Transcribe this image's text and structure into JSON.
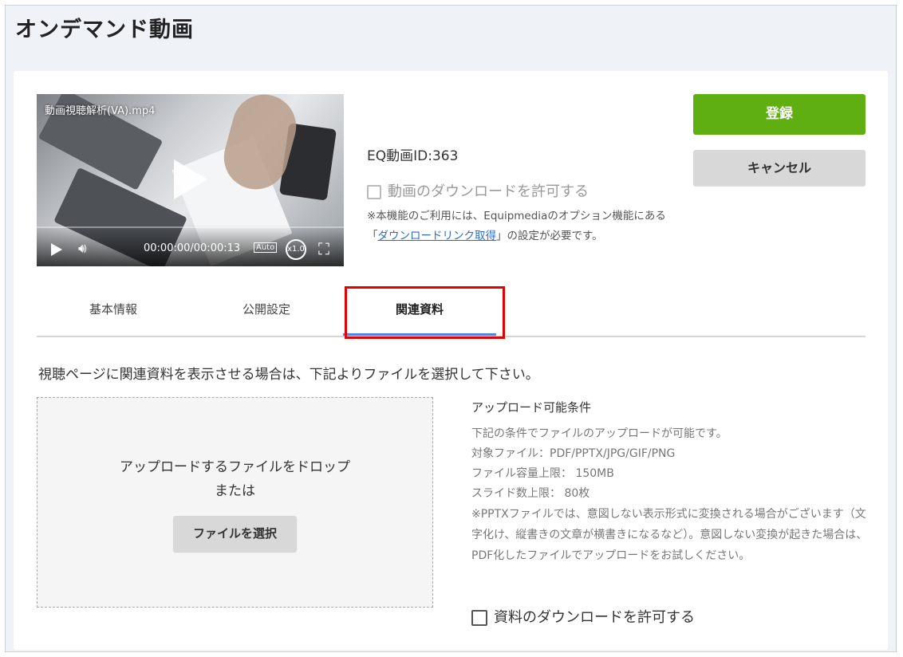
{
  "page": {
    "title": "オンデマンド動画"
  },
  "video": {
    "filename": "動画視聴解析(VA).mp4",
    "time": "00:00:00/00:00:13",
    "quality": "Auto",
    "speed": "x1.0"
  },
  "info": {
    "video_id": "EQ動画ID:363",
    "allow_video_download": "動画のダウンロードを許可する",
    "note_before": "※本機能のご利用には、Equipmediaのオプション機能にある「",
    "note_link": "ダウンロードリンク取得",
    "note_after": "」の設定が必要です。"
  },
  "buttons": {
    "register": "登録",
    "cancel": "キャンセル"
  },
  "tabs": [
    {
      "label": "基本情報",
      "active": false
    },
    {
      "label": "公開設定",
      "active": false
    },
    {
      "label": "関連資料",
      "active": true
    }
  ],
  "related": {
    "instruction": "視聴ページに関連資料を表示させる場合は、下記よりファイルを選択して下さい。",
    "drop_line1": "アップロードするファイルをドロップ",
    "drop_line2": "または",
    "select_file": "ファイルを選択",
    "conditions_title": "アップロード可能条件",
    "conditions": [
      "下記の条件でファイルのアップロードが可能です。",
      "対象ファイル：PDF/PPTX/JPG/GIF/PNG",
      "ファイル容量上限： 150MB",
      "スライド数上限： 80枚"
    ],
    "conditions_note": "※PPTXファイルでは、意図しない表示形式に変換される場合がございます（文字化け、縦書きの文章が横書きになるなど）。意図しない変換が起きた場合は、PDF化したファイルでアップロードをお試しください。",
    "allow_doc_download": "資料のダウンロードを許可する"
  },
  "colors": {
    "register": "#5fae12",
    "tab_active": "#4c87e0",
    "highlight": "#e00000"
  }
}
